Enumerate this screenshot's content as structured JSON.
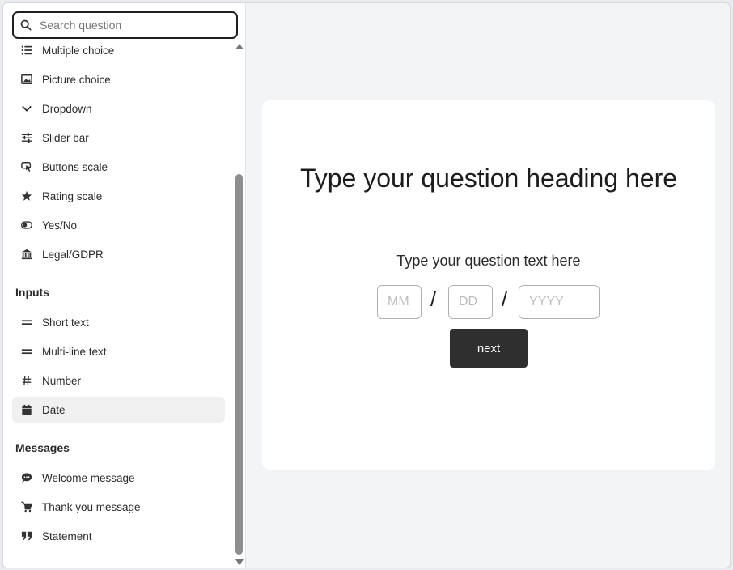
{
  "search": {
    "placeholder": "Search question"
  },
  "sidebar": {
    "choice_items": [
      {
        "label": "Multiple choice",
        "icon": "list-icon"
      },
      {
        "label": "Picture choice",
        "icon": "image-icon"
      },
      {
        "label": "Dropdown",
        "icon": "chevron-down-icon"
      },
      {
        "label": "Slider bar",
        "icon": "sliders-icon"
      },
      {
        "label": "Buttons scale",
        "icon": "cursor-click-icon"
      },
      {
        "label": "Rating scale",
        "icon": "star-icon"
      },
      {
        "label": "Yes/No",
        "icon": "toggle-icon"
      },
      {
        "label": "Legal/GDPR",
        "icon": "bank-icon"
      }
    ],
    "inputs_title": "Inputs",
    "input_items": [
      {
        "label": "Short text",
        "icon": "equals-icon"
      },
      {
        "label": "Multi-line text",
        "icon": "equals-icon"
      },
      {
        "label": "Number",
        "icon": "hash-icon"
      },
      {
        "label": "Date",
        "icon": "calendar-icon",
        "selected": true
      }
    ],
    "messages_title": "Messages",
    "message_items": [
      {
        "label": "Welcome message",
        "icon": "chat-bubble-icon"
      },
      {
        "label": "Thank you message",
        "icon": "cart-icon"
      },
      {
        "label": "Statement",
        "icon": "quote-icon"
      }
    ]
  },
  "preview": {
    "heading": "Type your question heading here",
    "text": "Type your question text here",
    "date": {
      "mm_placeholder": "MM",
      "dd_placeholder": "DD",
      "yyyy_placeholder": "YYYY",
      "separator": "/"
    },
    "next_label": "next"
  }
}
